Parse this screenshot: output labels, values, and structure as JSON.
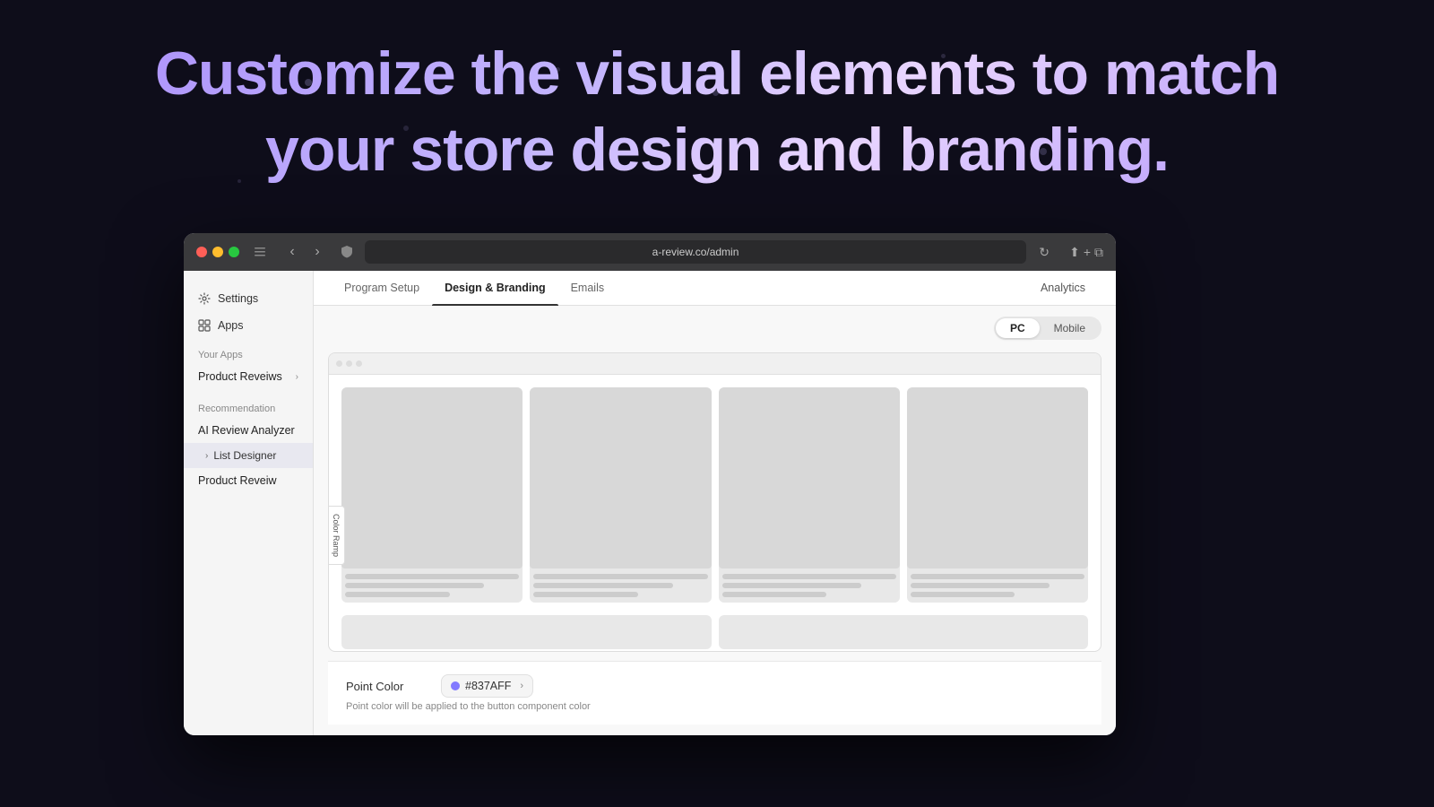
{
  "background": {
    "color": "#0e0d1a"
  },
  "hero": {
    "line1": "Customize the visual elements to match",
    "line2": "your store design and branding."
  },
  "browser": {
    "url": "a-review.co/admin",
    "traffic_lights": [
      "red",
      "yellow",
      "green"
    ]
  },
  "sidebar": {
    "settings_label": "Settings",
    "apps_label": "Apps",
    "your_apps_label": "Your Apps",
    "product_reviews_label": "Product Reveiws",
    "recommendation_label": "Recommendation",
    "ai_review_label": "AI Review Analyzer",
    "list_designer_label": "List Designer",
    "product_review_label": "Product Reveiw"
  },
  "tabs": {
    "items": [
      {
        "label": "Program Setup",
        "active": false
      },
      {
        "label": "Design & Branding",
        "active": true
      },
      {
        "label": "Emails",
        "active": false
      }
    ],
    "analytics_label": "Analytics"
  },
  "device_toggle": {
    "pc_label": "PC",
    "mobile_label": "Mobile",
    "active": "PC"
  },
  "mini_browser": {
    "color_ramp_label": "Color Ramp"
  },
  "config": {
    "point_color_label": "Point Color",
    "color_value": "#837AFF",
    "color_hex_display": "#837AFF",
    "hint_text": "Point color will be applied to the button component color"
  }
}
